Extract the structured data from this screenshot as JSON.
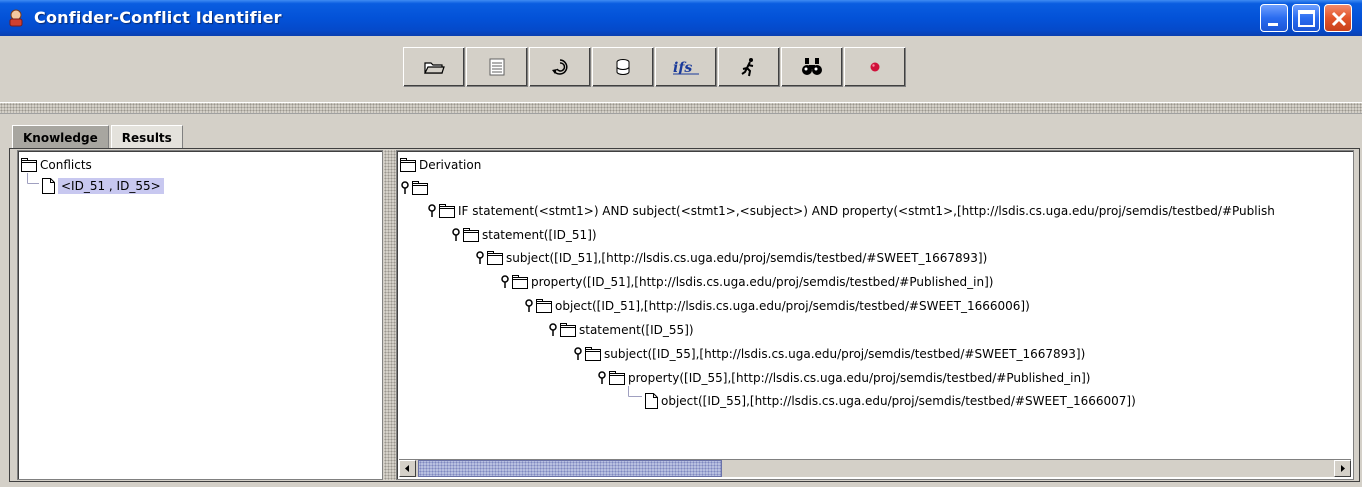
{
  "window": {
    "title": "Confider-Conflict Identifier"
  },
  "toolbar": {
    "buttons": [
      {
        "name": "open-folder-icon",
        "glyph": "🗀"
      },
      {
        "name": "document-list-icon",
        "glyph": "≣"
      },
      {
        "name": "reload-icon",
        "glyph": "⟳"
      },
      {
        "name": "database-icon",
        "glyph": "⛁"
      },
      {
        "name": "ifs-icon",
        "glyph": "ifs"
      },
      {
        "name": "run-icon",
        "glyph": "🏃"
      },
      {
        "name": "binoculars-icon",
        "glyph": "👁"
      },
      {
        "name": "stop-record-icon",
        "glyph": "●"
      }
    ]
  },
  "tabs": [
    {
      "label": "Knowledge",
      "active": true
    },
    {
      "label": "Results",
      "active": false
    }
  ],
  "left_tree": {
    "root": "Conflicts",
    "children": [
      "<ID_51 , ID_55>"
    ]
  },
  "right_tree": {
    "root": "Derivation",
    "rule": "IF statement(<stmt1>) AND subject(<stmt1>,<subject>) AND property(<stmt1>,[http://lsdis.cs.uga.edu/proj/semdis/testbed/#Publish",
    "nodes": [
      "statement([ID_51])",
      "subject([ID_51],[http://lsdis.cs.uga.edu/proj/semdis/testbed/#SWEET_1667893])",
      "property([ID_51],[http://lsdis.cs.uga.edu/proj/semdis/testbed/#Published_in])",
      "object([ID_51],[http://lsdis.cs.uga.edu/proj/semdis/testbed/#SWEET_1666006])",
      "statement([ID_55])",
      "subject([ID_55],[http://lsdis.cs.uga.edu/proj/semdis/testbed/#SWEET_1667893])",
      "property([ID_55],[http://lsdis.cs.uga.edu/proj/semdis/testbed/#Published_in])",
      "object([ID_55],[http://lsdis.cs.uga.edu/proj/semdis/testbed/#SWEET_1666007])"
    ]
  },
  "colors": {
    "titlebar": "#0352d8",
    "selection": "#c8c8f0",
    "chrome": "#d4d0c8"
  }
}
